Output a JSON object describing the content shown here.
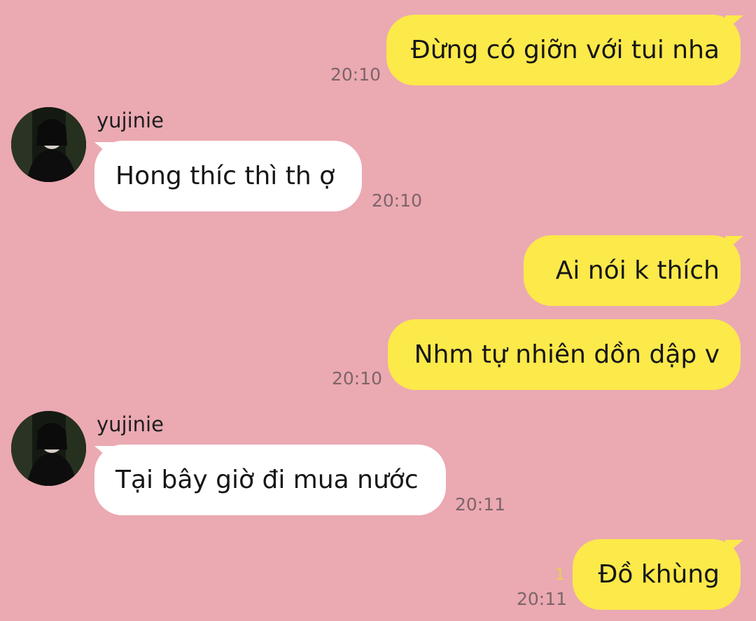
{
  "colors": {
    "background": "#EBA9B2",
    "outgoing_bubble": "#FCE94A",
    "incoming_bubble": "#FFFFFF",
    "timestamp": "#7C6569",
    "unread_count": "#E9D24C"
  },
  "messages": [
    {
      "direction": "outgoing",
      "text": "Đừng có giỡn với tui nha",
      "time": "20:10"
    },
    {
      "direction": "incoming",
      "sender": "yujinie",
      "text": "Hong thíc thì th ợ",
      "time": "20:10"
    },
    {
      "direction": "outgoing",
      "text": "Ai nói k thích",
      "time": ""
    },
    {
      "direction": "outgoing",
      "text": "Nhm tự nhiên dồn dập v",
      "time": "20:10"
    },
    {
      "direction": "incoming",
      "sender": "yujinie",
      "text": "Tại bây giờ đi mua nước",
      "time": "20:11"
    },
    {
      "direction": "outgoing",
      "text": "Đồ khùng",
      "time": "20:11",
      "unread": "1"
    }
  ]
}
